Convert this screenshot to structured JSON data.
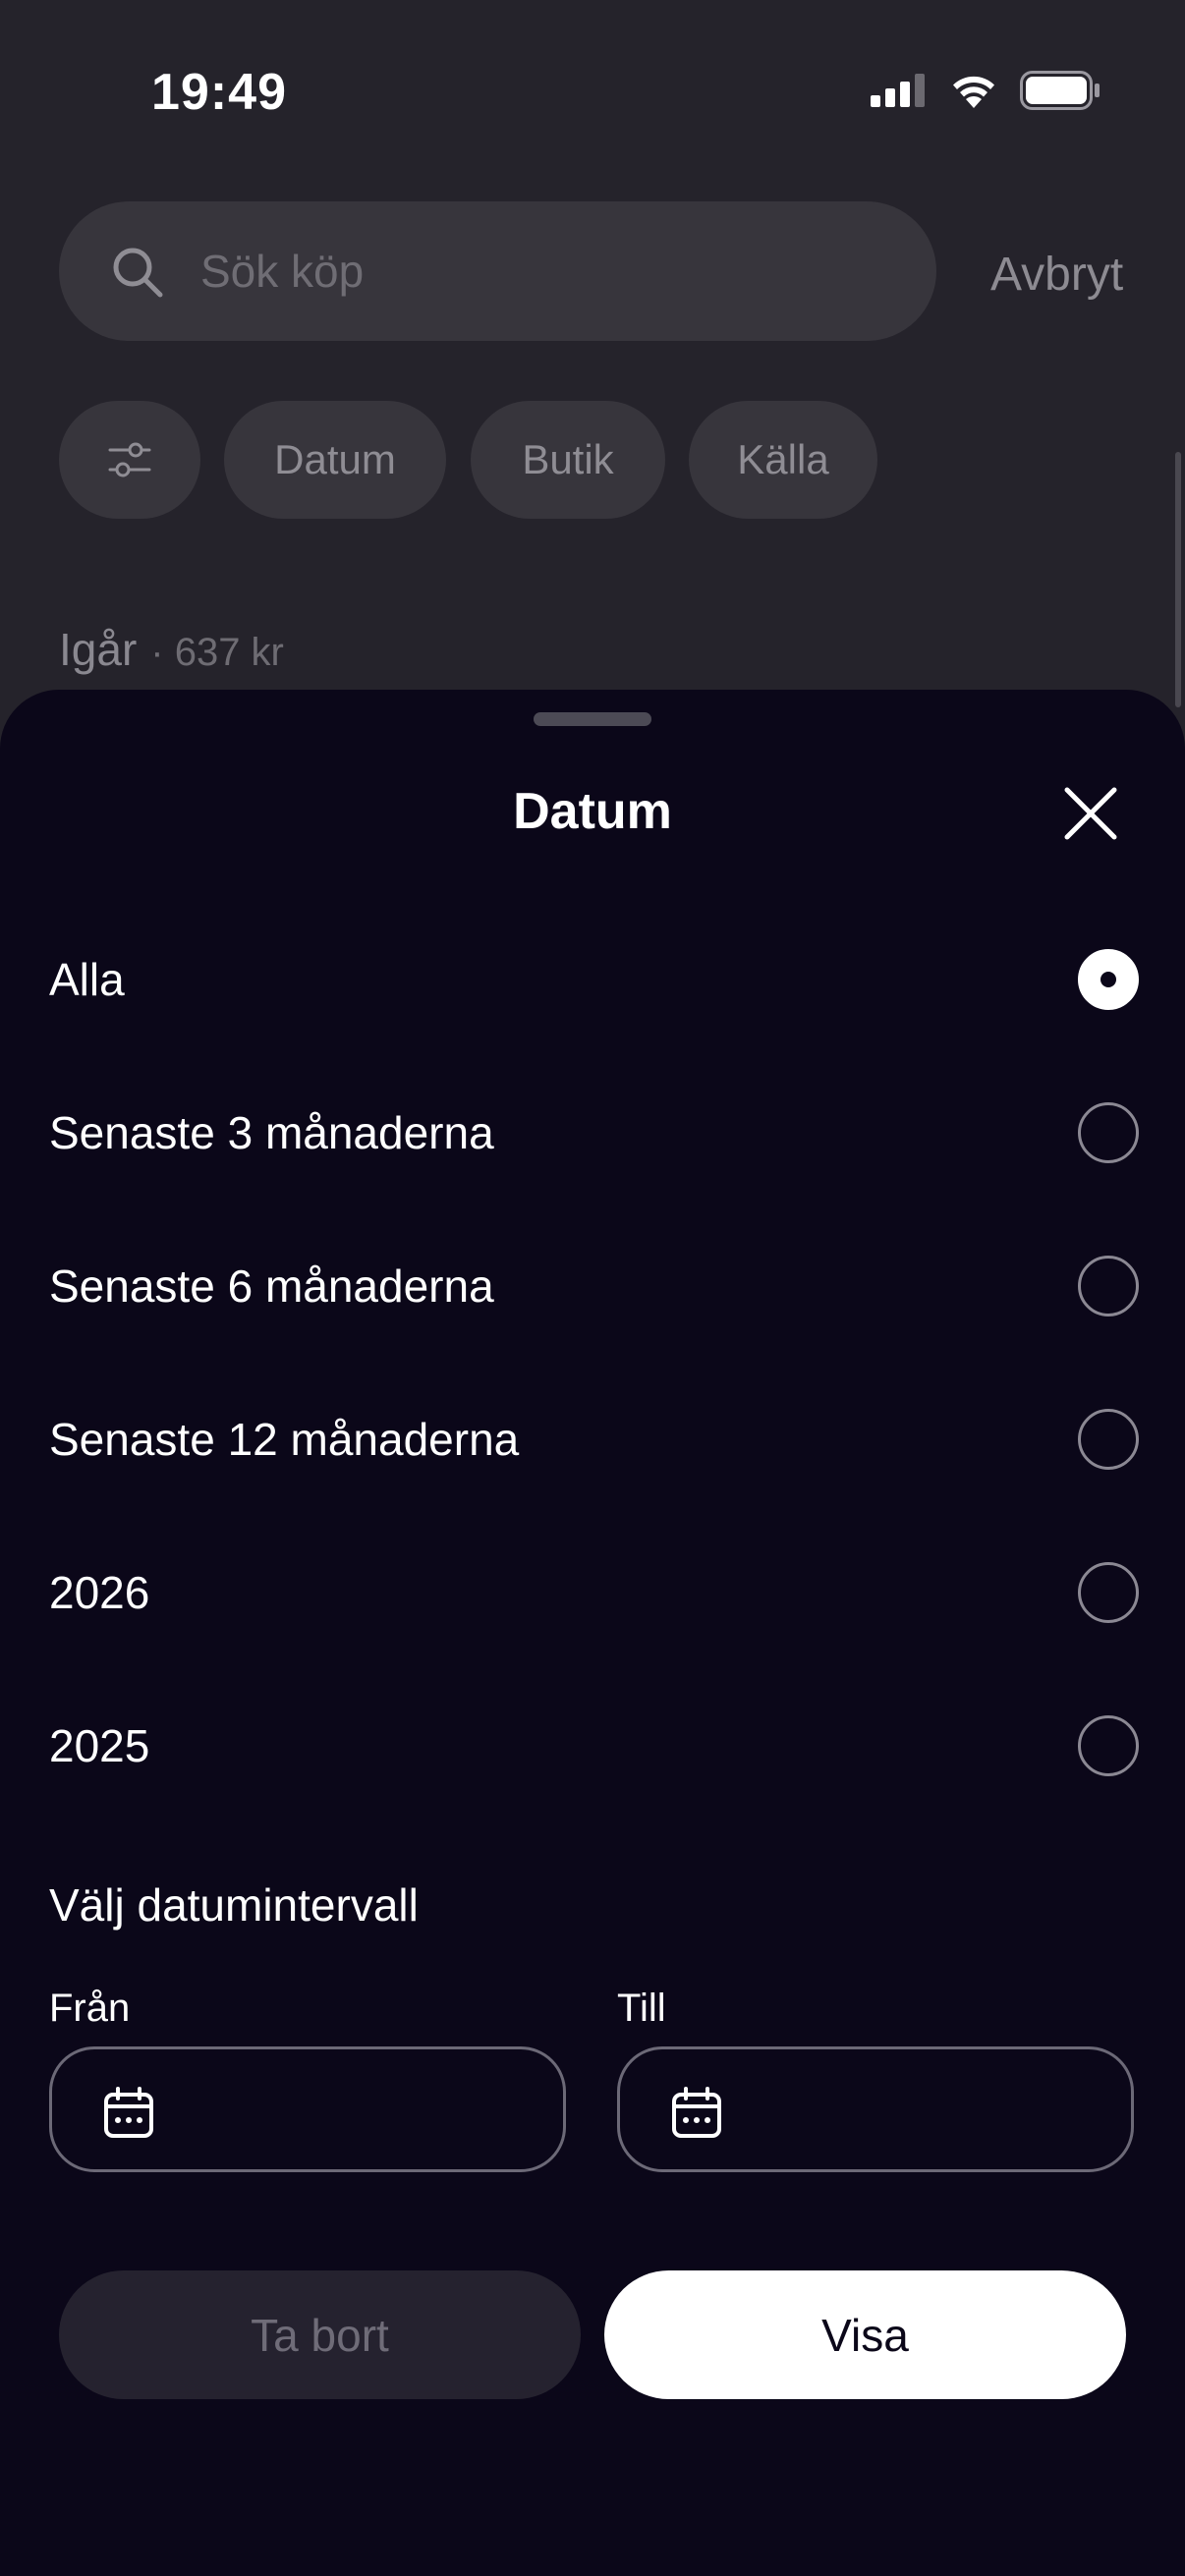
{
  "status_bar": {
    "time": "19:49"
  },
  "search": {
    "placeholder": "Sök köp",
    "cancel_label": "Avbryt"
  },
  "chips": [
    "Datum",
    "Butik",
    "Källa"
  ],
  "list": {
    "section_label": "Igår",
    "section_amount": "· 637 kr"
  },
  "sheet": {
    "title": "Datum",
    "options": [
      {
        "label": "Alla",
        "selected": true
      },
      {
        "label": "Senaste 3 månaderna",
        "selected": false
      },
      {
        "label": "Senaste 6 månaderna",
        "selected": false
      },
      {
        "label": "Senaste 12 månaderna",
        "selected": false
      },
      {
        "label": "2026",
        "selected": false
      },
      {
        "label": "2025",
        "selected": false
      }
    ],
    "range": {
      "heading": "Välj datumintervall",
      "from_label": "Från",
      "to_label": "Till"
    },
    "buttons": {
      "remove_label": "Ta bort",
      "show_label": "Visa"
    }
  },
  "colors": {
    "sheet_background": "#0b0719",
    "page_background": "#25232b",
    "primary_button": "#ffffff"
  }
}
